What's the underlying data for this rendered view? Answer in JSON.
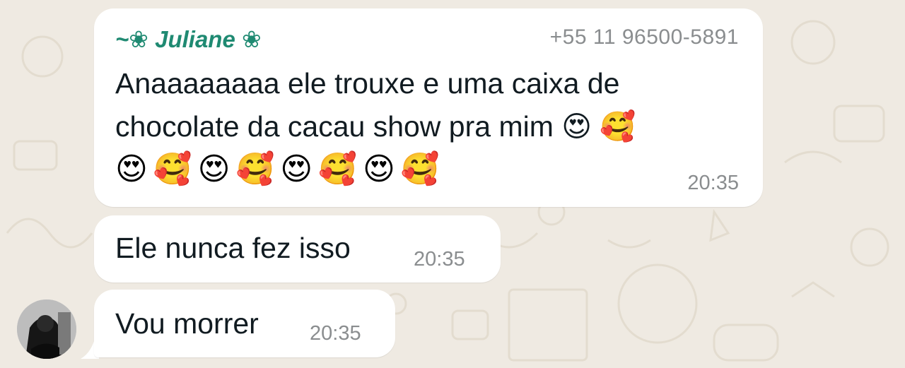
{
  "chat": {
    "messages": [
      {
        "sender": "~❀ Juliane ❀",
        "sender_phone": "+55 11 96500-5891",
        "text_line1": "Anaaaaaaaa ele trouxe e uma caixa de",
        "text_line2": "chocolate da cacau show pra mim 😍 🥰",
        "emoji_line": "😍🥰😍🥰😍🥰😍🥰",
        "time": "20:35"
      },
      {
        "text": "Ele nunca fez isso",
        "time": "20:35"
      },
      {
        "text": "Vou morrer",
        "time": "20:35"
      }
    ],
    "colors": {
      "background": "#efeae2",
      "bubble": "#ffffff",
      "sender_name": "#1f8a72",
      "meta_text": "#8a8d8f",
      "body_text": "#111b21"
    },
    "avatar_icon": "contact-photo"
  }
}
